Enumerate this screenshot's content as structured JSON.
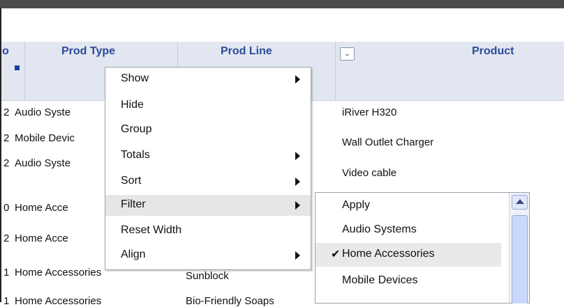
{
  "table": {
    "columns": [
      {
        "label": "o"
      },
      {
        "label": "Prod Type"
      },
      {
        "label": "Prod Line"
      },
      {
        "label": "Product"
      }
    ],
    "rows": [
      {
        "num": "2",
        "type": "Audio Syste",
        "line": "",
        "product": "iRiver H320"
      },
      {
        "num": "2",
        "type": "Mobile Devic",
        "line": "",
        "product": "Wall Outlet Charger"
      },
      {
        "num": "2",
        "type": "Audio Syste",
        "line": "",
        "product": "Video cable"
      },
      {
        "num": "0",
        "type": "Home Acce",
        "line": "",
        "product": ""
      },
      {
        "num": "2",
        "type": "Home Acce",
        "line": "",
        "product": ""
      },
      {
        "num": "1",
        "type": "Home Accessories",
        "line": "Sunblock",
        "product": ""
      },
      {
        "num": "1",
        "type": "Home Accessories",
        "line": "Bio-Friendly Soaps",
        "product": ""
      }
    ]
  },
  "context_menu": {
    "items": [
      {
        "label": "Show",
        "submenu": true
      },
      {
        "label": "Hide",
        "submenu": false
      },
      {
        "label": "Group",
        "submenu": false
      },
      {
        "label": "Totals",
        "submenu": true
      },
      {
        "label": "Sort",
        "submenu": true
      },
      {
        "label": "Filter",
        "submenu": true,
        "highlighted": true
      },
      {
        "label": "Reset Width",
        "submenu": false
      },
      {
        "label": "Align",
        "submenu": true
      }
    ]
  },
  "filter_submenu": {
    "items": [
      {
        "label": "Apply",
        "checked": false
      },
      {
        "label": "Audio Systems",
        "checked": false
      },
      {
        "label": "Home Accessories",
        "checked": true
      },
      {
        "label": "Mobile Devices",
        "checked": false
      }
    ],
    "check_glyph": "✔"
  },
  "colors": {
    "header_bg": "#e1e6f0",
    "header_text": "#2b4a9a",
    "highlight": "#e6e6e6"
  }
}
